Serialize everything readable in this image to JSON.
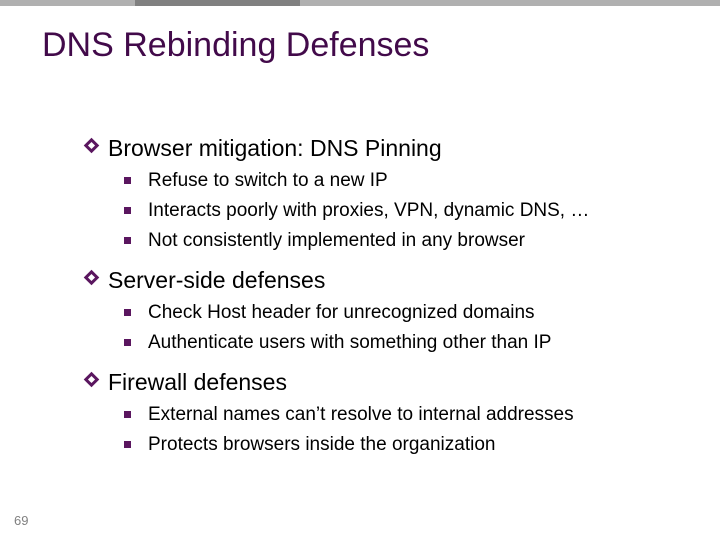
{
  "title": "DNS Rebinding Defenses",
  "page_number": "69",
  "sections": {
    "0": {
      "heading": "Browser mitigation: DNS Pinning",
      "items": {
        "0": "Refuse to switch to a new IP",
        "1": "Interacts poorly with proxies, VPN, dynamic DNS, …",
        "2": "Not consistently implemented in any browser"
      }
    },
    "1": {
      "heading": "Server-side defenses",
      "items": {
        "0": "Check Host header for unrecognized domains",
        "1": "Authenticate users with something other than IP"
      }
    },
    "2": {
      "heading": "Firewall defenses",
      "items": {
        "0": "External names can’t resolve to internal addresses",
        "1": "Protects browsers inside the organization"
      }
    }
  }
}
